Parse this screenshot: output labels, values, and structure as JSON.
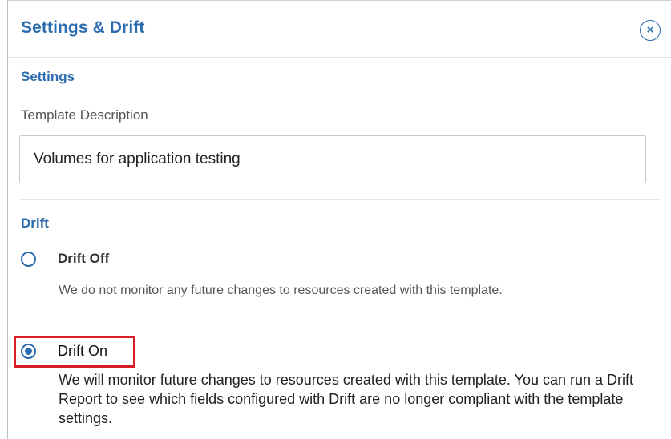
{
  "panel": {
    "title": "Settings & Drift",
    "close_icon": "close-icon",
    "close_glyph": "×",
    "accent_color": "#2b6cb0"
  },
  "settings": {
    "heading": "Settings",
    "template_description_label": "Template Description",
    "template_description_value": "Volumes for application testing"
  },
  "drift": {
    "heading": "Drift",
    "selected": "Drift On",
    "options": [
      {
        "label": "Drift Off",
        "checked": false,
        "description": "We do not monitor any future changes to resources created with this template."
      },
      {
        "label": "Drift On",
        "checked": true,
        "description": "We will monitor future changes to resources created with this template. You can run a Drift Report to see which fields configured with Drift are no longer compliant with the template settings."
      }
    ],
    "highlight_color": "#d81f26"
  }
}
